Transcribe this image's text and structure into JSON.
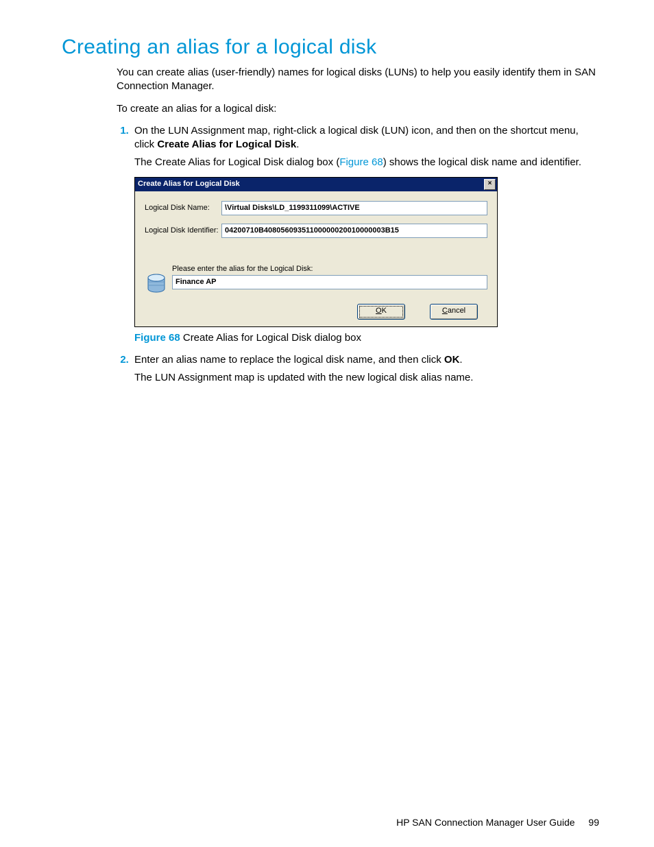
{
  "heading": "Creating an alias for a logical disk",
  "intro_para": "You can create alias (user-friendly) names for logical disks (LUNs) to help you easily identify them in SAN Connection Manager.",
  "lead_in": "To create an alias for a logical disk:",
  "step1_a": "On the LUN Assignment map, right-click a logical disk (LUN) icon, and then on the shortcut menu, click ",
  "step1_bold": "Create Alias for Logical Disk",
  "step1_period": ".",
  "step1_sub_a": "The Create Alias for Logical Disk dialog box (",
  "step1_sub_link": "Figure 68",
  "step1_sub_b": ") shows the logical disk name and identifier.",
  "dialog": {
    "title": "Create Alias for Logical Disk",
    "close_glyph": "×",
    "name_label": "Logical Disk Name:",
    "name_value": "\\Virtual Disks\\LD_1199311099\\ACTIVE",
    "id_label": "Logical Disk Identifier:",
    "id_value": "04200710B40805609351100000020010000003B15",
    "alias_prompt": "Please enter the alias for the Logical Disk:",
    "alias_value": "Finance AP",
    "ok_u": "O",
    "ok_rest": "K",
    "cancel_u": "C",
    "cancel_rest": "ancel"
  },
  "figure_label": "Figure 68",
  "figure_caption": " Create Alias for Logical Disk dialog box",
  "step2_a": "Enter an alias name to replace the logical disk name, and then click ",
  "step2_bold": "OK",
  "step2_period": ".",
  "step2_sub": "The LUN Assignment map is updated with the new logical disk alias name.",
  "footer_title": "HP SAN Connection Manager User Guide",
  "footer_page": "99"
}
